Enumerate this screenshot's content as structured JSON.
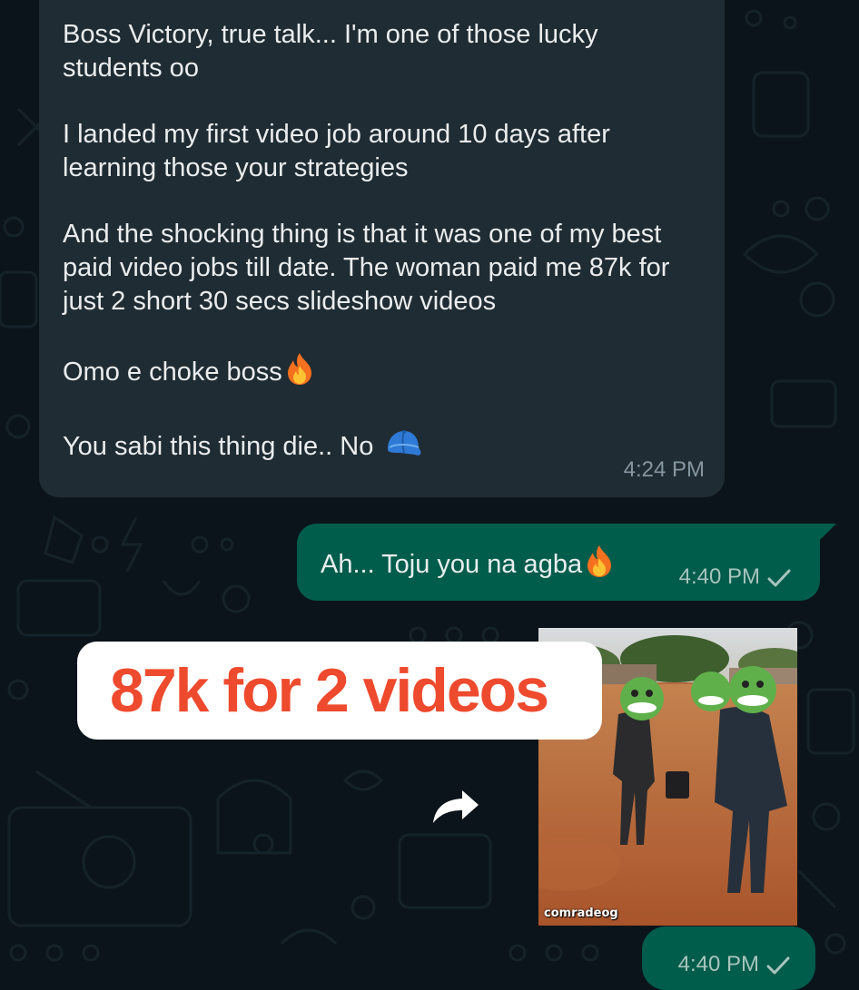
{
  "chat": {
    "incoming": {
      "paragraphs": [
        "Boss Victory, true talk... I'm one of those lucky students oo",
        "I landed my first video job around 10 days after learning those your strategies",
        "And the shocking thing is that it was one of my best paid video jobs till date. The woman paid me 87k for just 2 short 30 secs slideshow videos",
        "Omo e choke boss",
        "You sabi this thing die.. No"
      ],
      "time": "4:24 PM",
      "emoji_4": "fire-emoji",
      "emoji_5": "blue-cap-emoji"
    },
    "outgoing": {
      "text": "Ah... Toju you na agba",
      "emoji": "fire-emoji",
      "time": "4:40 PM",
      "status": "sent-check-icon"
    },
    "media_message": {
      "watermark": "comradeog",
      "time": "4:40 PM",
      "status": "sent-check-icon"
    }
  },
  "overlay": {
    "caption": "87k for 2 videos",
    "color": "#ee4a2e"
  },
  "forward_icon": "forward-arrow-icon",
  "colors": {
    "background": "#0b141a",
    "incoming_bubble": "#202c33",
    "outgoing_bubble": "#005c4b"
  }
}
